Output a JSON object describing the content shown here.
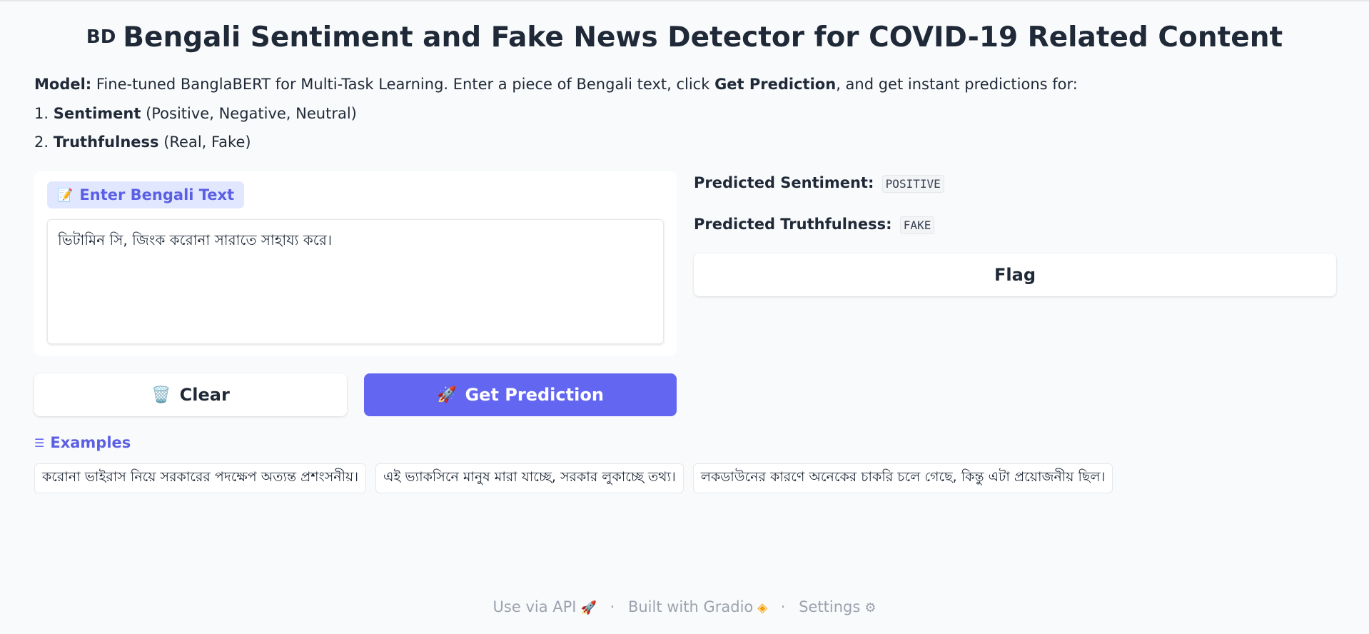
{
  "header": {
    "flag_text": "BD",
    "title": "Bengali Sentiment and Fake News Detector for COVID-19 Related Content"
  },
  "description": {
    "model_label": "Model:",
    "model_text_before": " Fine-tuned BanglaBERT for Multi-Task Learning. Enter a piece of Bengali text, click ",
    "model_text_bold": "Get Prediction",
    "model_text_after": ", and get instant predictions for:",
    "item1_num": "1. ",
    "item1_bold": "Sentiment",
    "item1_rest": " (Positive, Negative, Neutral)",
    "item2_num": "2. ",
    "item2_bold": "Truthfulness",
    "item2_rest": " (Real, Fake)"
  },
  "input": {
    "label": "Enter Bengali Text",
    "label_icon": "memo-icon",
    "value": "ভিটামিন সি, জিংক করোনা সারাতে সাহায্য করে।"
  },
  "buttons": {
    "clear_label": "Clear",
    "clear_icon": "wastebasket-icon",
    "predict_label": "Get Prediction",
    "predict_icon": "rocket-icon",
    "flag_label": "Flag"
  },
  "output": {
    "sentiment_label": "Predicted Sentiment:",
    "sentiment_value": "POSITIVE",
    "truth_label": "Predicted Truthfulness:",
    "truth_value": "FAKE"
  },
  "examples": {
    "label": "Examples",
    "items": [
      "করোনা ভাইরাস নিয়ে সরকারের পদক্ষেপ অত্যন্ত প্রশংসনীয়।",
      "এই ভ্যাকসিনে মানুষ মারা যাচ্ছে, সরকার লুকাচ্ছে তথ্য।",
      "লকডাউনের কারণে অনেকের চাকরি চলে গেছে, কিন্তু এটা প্রয়োজনীয় ছিল।"
    ]
  },
  "footer": {
    "api_label": "Use via API",
    "separator": "·",
    "gradio_label": "Built with Gradio",
    "settings_label": "Settings"
  },
  "colors": {
    "accent": "#6366f1",
    "accent_text": "#5b5fe3",
    "background": "#f9fafb"
  }
}
